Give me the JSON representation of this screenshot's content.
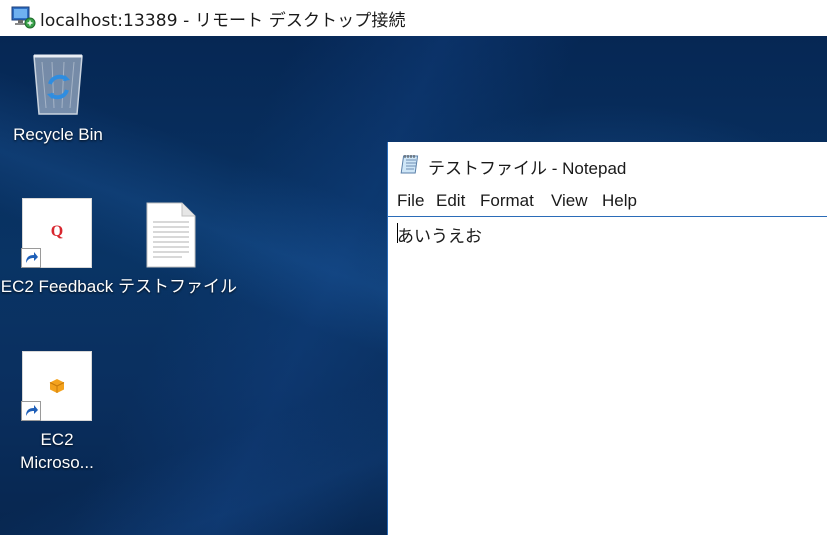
{
  "rdp_window": {
    "title": "localhost:13389 - リモート デスクトップ接続",
    "icon": "remote-desktop-icon"
  },
  "desktop": {
    "icons": [
      {
        "label": "Recycle Bin",
        "icon": "recycle-bin-icon"
      },
      {
        "label": "EC2 Feedback",
        "icon": "ec2-feedback-icon"
      },
      {
        "label": "テストファイル",
        "icon": "text-file-icon"
      },
      {
        "label_line1": "EC2",
        "label_line2": "Microso...",
        "icon": "ec2-microsoft-icon"
      }
    ]
  },
  "notepad": {
    "title": "テストファイル - Notepad",
    "menu": [
      "File",
      "Edit",
      "Format",
      "View",
      "Help"
    ],
    "content": "あいうえお"
  },
  "colors": {
    "desktop_bg": "#093465",
    "accent_border": "#2b6cb8",
    "feedback_red": "#d8262e",
    "ec2_orange": "#f4a21c"
  }
}
